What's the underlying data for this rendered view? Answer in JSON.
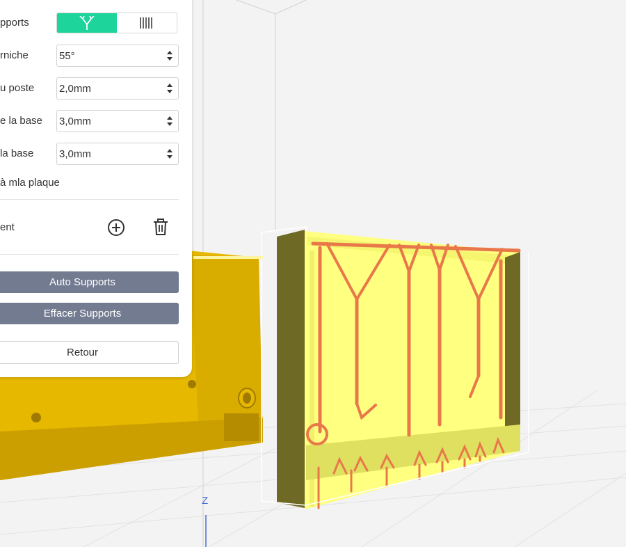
{
  "panel": {
    "supports_label": "pports",
    "support_types": [
      {
        "name": "tree-supports",
        "active": true
      },
      {
        "name": "linear-supports",
        "active": false
      }
    ],
    "corniche_label": "rniche",
    "corniche_value": "55°",
    "poste_label": "u poste",
    "poste_value": "2,0mm",
    "base1_label": "e la base",
    "base1_value": "3,0mm",
    "base2_label": " la base",
    "base2_value": "3,0mm",
    "plate_label": "à mla plaque",
    "element_label": "ent",
    "auto_supports": "Auto Supports",
    "clear_supports": "Effacer Supports",
    "back": "Retour"
  },
  "viewport": {
    "axis_label": "Z"
  },
  "colors": {
    "accent": "#1dd59a",
    "button_dark": "#737b91",
    "model_selected": "#ffff80",
    "model_other": "#e6b800",
    "supports": "#e8784a"
  }
}
